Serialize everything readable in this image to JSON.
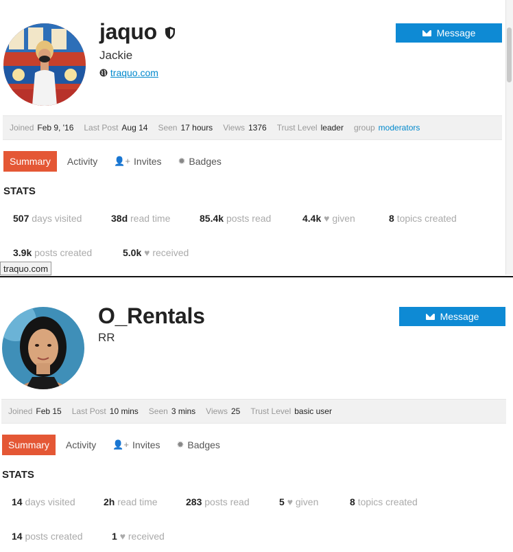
{
  "profiles": [
    {
      "username": "jaquo",
      "real_name": "Jackie",
      "website": "traquo.com",
      "message_label": "Message",
      "info": {
        "joined_label": "Joined",
        "joined": "Feb 9, '16",
        "last_post_label": "Last Post",
        "last_post": "Aug 14",
        "seen_label": "Seen",
        "seen": "17 hours",
        "views_label": "Views",
        "views": "1376",
        "trust_label": "Trust Level",
        "trust": "leader",
        "group_label": "group",
        "group": "moderators"
      },
      "tabs": [
        "Summary",
        "Activity",
        "Invites",
        "Badges"
      ],
      "stats_heading": "STATS",
      "stats": {
        "days_visited": "507",
        "days_visited_label": "days visited",
        "read_time": "38d",
        "read_time_label": "read time",
        "posts_read": "85.4k",
        "posts_read_label": "posts read",
        "given": "4.4k",
        "given_label": "given",
        "topics_created": "8",
        "topics_created_label": "topics created",
        "posts_created": "3.9k",
        "posts_created_label": "posts created",
        "received": "5.0k",
        "received_label": "received"
      },
      "tooltip": "traquo.com"
    },
    {
      "username": "O_Rentals",
      "real_name": "RR",
      "message_label": "Message",
      "info": {
        "joined_label": "Joined",
        "joined": "Feb 15",
        "last_post_label": "Last Post",
        "last_post": "10 mins",
        "seen_label": "Seen",
        "seen": "3 mins",
        "views_label": "Views",
        "views": "25",
        "trust_label": "Trust Level",
        "trust": "basic user"
      },
      "tabs": [
        "Summary",
        "Activity",
        "Invites",
        "Badges"
      ],
      "stats_heading": "STATS",
      "stats": {
        "days_visited": "14",
        "days_visited_label": "days visited",
        "read_time": "2h",
        "read_time_label": "read time",
        "posts_read": "283",
        "posts_read_label": "posts read",
        "given": "5",
        "given_label": "given",
        "topics_created": "8",
        "topics_created_label": "topics created",
        "posts_created": "14",
        "posts_created_label": "posts created",
        "received": "1",
        "received_label": "received"
      }
    }
  ],
  "icons": {
    "shield": "shield-icon",
    "globe": "globe-icon",
    "envelope": "envelope-icon",
    "user_plus": "user-plus-icon",
    "badge": "badge-icon",
    "heart": "heart-icon"
  },
  "colors": {
    "accent_orange": "#e45735",
    "button_blue": "#0e8ad4",
    "link_blue": "#0088cc"
  }
}
